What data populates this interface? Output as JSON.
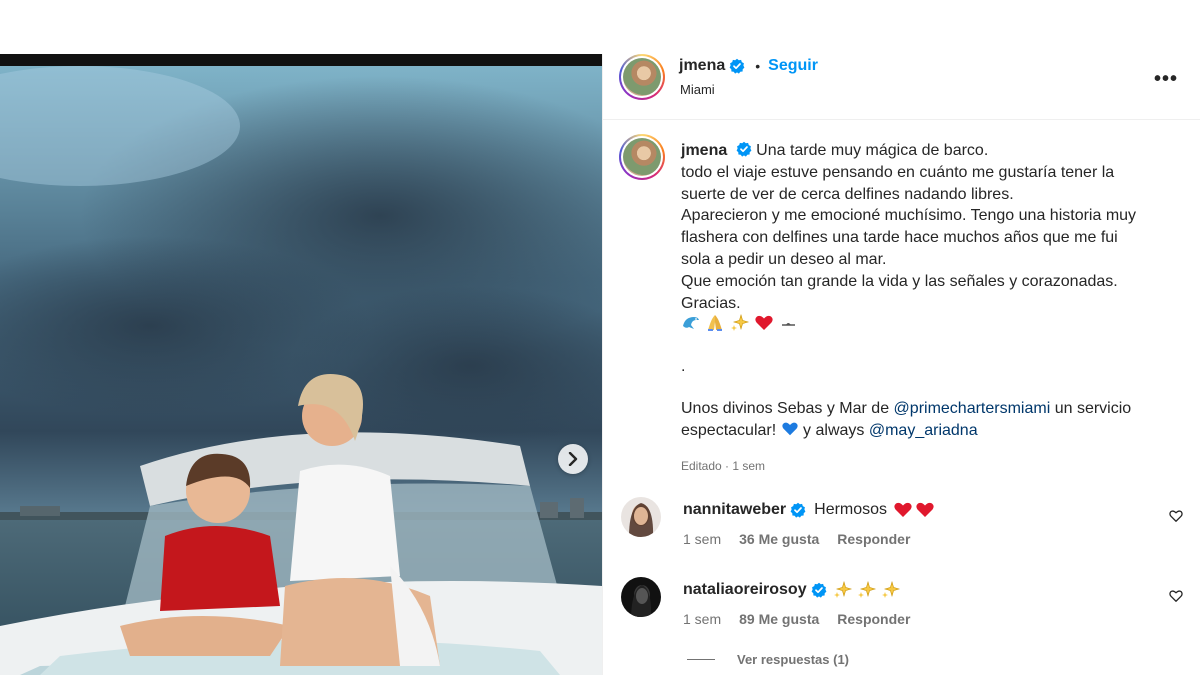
{
  "post": {
    "username": "jmena",
    "follow_label": "Seguir",
    "location": "Miami",
    "more_icon": "more-horizontal-icon"
  },
  "caption": {
    "line1": "Una tarde muy mágica de barco.",
    "line2": "todo el viaje estuve pensando en cuánto me gustaría tener la",
    "line3": "suerte de ver de cerca delfines nadando libres.",
    "line4": "Aparecieron y me emocioné muchísimo. Tengo una historia muy",
    "line5": "flashera con delfines una tarde hace muchos años que me fui",
    "line6": "sola a pedir un deseo al mar.",
    "line7": "Que emoción tan grande la vida y las señales y corazonadas.",
    "line8": "Gracias.",
    "emojis": [
      "dolphin",
      "folded-hands",
      "sparkles",
      "red-heart",
      "ocean-horizon"
    ],
    "dot": ".",
    "line9_pre": "Unos divinos Sebas y Mar de ",
    "mention1": "@primechartersmiami",
    "line9_post": " un servicio",
    "line10_pre": "espectacular! ",
    "line10_mid": " y always ",
    "mention2": "@may_ariadna",
    "edited": "Editado · 1 sem"
  },
  "comments": [
    {
      "username": "nannitaweber",
      "text": "Hermosos",
      "emojis": [
        "red-heart",
        "red-heart"
      ],
      "time": "1 sem",
      "likes": "36 Me gusta",
      "reply": "Responder"
    },
    {
      "username": "nataliaoreirosoy",
      "text": "",
      "emojis": [
        "sparkles",
        "sparkles",
        "sparkles"
      ],
      "time": "1 sem",
      "likes": "89 Me gusta",
      "reply": "Responder"
    }
  ],
  "view_replies": "Ver respuestas (1)",
  "colors": {
    "link": "#0095f6",
    "mention": "#00376b",
    "verified": "#0095f6",
    "muted": "#737373"
  }
}
